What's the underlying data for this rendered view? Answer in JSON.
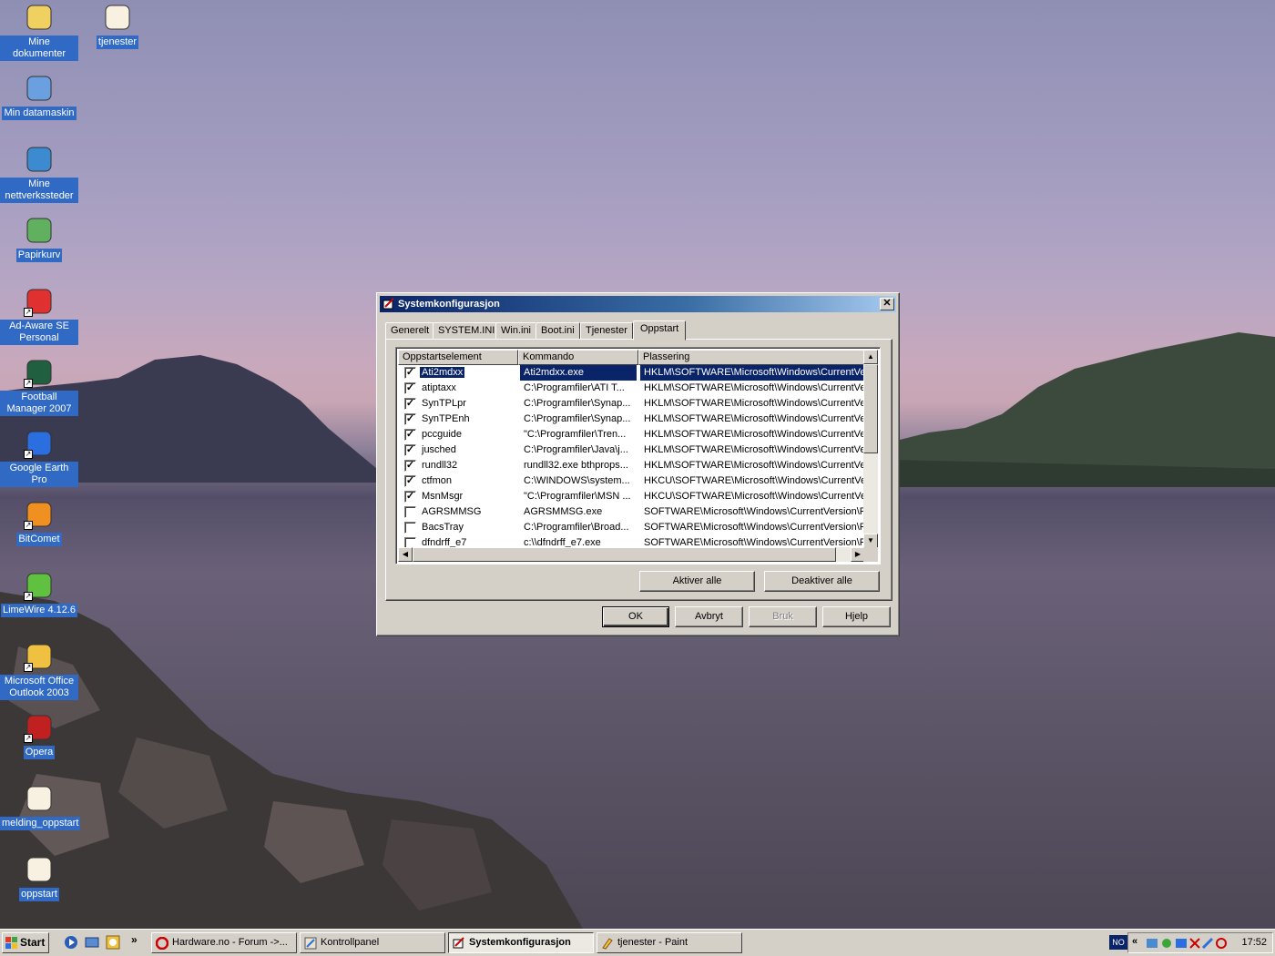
{
  "desktop": {
    "icons": [
      {
        "label": "Mine dokumenter",
        "icon": "folder-icon"
      },
      {
        "label": "tjenester",
        "icon": "paint-image-icon"
      },
      {
        "label": "Min datamaskin",
        "icon": "computer-icon"
      },
      {
        "label": "Mine nettverkssteder",
        "icon": "network-icon"
      },
      {
        "label": "Papirkurv",
        "icon": "recycle-bin-icon"
      },
      {
        "label": "Ad-Aware SE Personal",
        "icon": "adaware-icon"
      },
      {
        "label": "Football Manager 2007",
        "icon": "football-manager-icon"
      },
      {
        "label": "Google Earth Pro",
        "icon": "google-earth-icon"
      },
      {
        "label": "BitComet",
        "icon": "bitcomet-icon"
      },
      {
        "label": "LimeWire 4.12.6",
        "icon": "limewire-icon"
      },
      {
        "label": "Microsoft Office Outlook 2003",
        "icon": "outlook-icon"
      },
      {
        "label": "Opera",
        "icon": "opera-icon"
      },
      {
        "label": "melding_oppstart",
        "icon": "paint-image-icon"
      },
      {
        "label": "oppstart",
        "icon": "paint-image-icon"
      }
    ]
  },
  "dialog": {
    "title": "Systemkonfigurasjon",
    "close_glyph": "✕",
    "tabs": [
      "Generelt",
      "SYSTEM.INI",
      "Win.ini",
      "Boot.ini",
      "Tjenester",
      "Oppstart"
    ],
    "active_tab": "Oppstart",
    "columns": [
      "Oppstartselement",
      "Kommando",
      "Plassering"
    ],
    "rows": [
      {
        "checked": true,
        "item": "Ati2mdxx",
        "command": "Ati2mdxx.exe",
        "location": "HKLM\\SOFTWARE\\Microsoft\\Windows\\CurrentVer...",
        "selected": true
      },
      {
        "checked": true,
        "item": "atiptaxx",
        "command": "C:\\Programfiler\\ATI T...",
        "location": "HKLM\\SOFTWARE\\Microsoft\\Windows\\CurrentVer..."
      },
      {
        "checked": true,
        "item": "SynTPLpr",
        "command": "C:\\Programfiler\\Synap...",
        "location": "HKLM\\SOFTWARE\\Microsoft\\Windows\\CurrentVer..."
      },
      {
        "checked": true,
        "item": "SynTPEnh",
        "command": "C:\\Programfiler\\Synap...",
        "location": "HKLM\\SOFTWARE\\Microsoft\\Windows\\CurrentVer..."
      },
      {
        "checked": true,
        "item": "pccguide",
        "command": "\"C:\\Programfiler\\Tren...",
        "location": "HKLM\\SOFTWARE\\Microsoft\\Windows\\CurrentVer..."
      },
      {
        "checked": true,
        "item": "jusched",
        "command": "C:\\Programfiler\\Java\\j...",
        "location": "HKLM\\SOFTWARE\\Microsoft\\Windows\\CurrentVer..."
      },
      {
        "checked": true,
        "item": "rundll32",
        "command": "rundll32.exe bthprops...",
        "location": "HKLM\\SOFTWARE\\Microsoft\\Windows\\CurrentVer..."
      },
      {
        "checked": true,
        "item": "ctfmon",
        "command": "C:\\WINDOWS\\system...",
        "location": "HKCU\\SOFTWARE\\Microsoft\\Windows\\CurrentVer..."
      },
      {
        "checked": true,
        "item": "MsnMsgr",
        "command": "\"C:\\Programfiler\\MSN ...",
        "location": "HKCU\\SOFTWARE\\Microsoft\\Windows\\CurrentVer..."
      },
      {
        "checked": false,
        "item": "AGRSMMSG",
        "command": "AGRSMMSG.exe",
        "location": "SOFTWARE\\Microsoft\\Windows\\CurrentVersion\\Ru..."
      },
      {
        "checked": false,
        "item": "BacsTray",
        "command": "C:\\Programfiler\\Broad...",
        "location": "SOFTWARE\\Microsoft\\Windows\\CurrentVersion\\Ru..."
      },
      {
        "checked": false,
        "item": "dfndrff_e7",
        "command": "c:\\\\dfndrff_e7.exe",
        "location": "SOFTWARE\\Microsoft\\Windows\\CurrentVersion\\Ru..."
      }
    ],
    "enable_all_label": "Aktiver alle",
    "disable_all_label": "Deaktiver alle",
    "ok_label": "OK",
    "cancel_label": "Avbryt",
    "apply_label": "Bruk",
    "help_label": "Hjelp"
  },
  "taskbar": {
    "start_label": "Start",
    "overflow_glyph": "»",
    "tasks": [
      {
        "label": "Hardware.no - Forum ->...",
        "icon": "opera-icon",
        "active": false
      },
      {
        "label": "Kontrollpanel",
        "icon": "control-panel-icon",
        "active": false
      },
      {
        "label": "Systemkonfigurasjon",
        "icon": "msconfig-icon",
        "active": true
      },
      {
        "label": "tjenester - Paint",
        "icon": "paint-icon",
        "active": false
      }
    ],
    "language": "NO",
    "tray_expand": "«",
    "clock": "17:52"
  },
  "colors": {
    "selection": "#0a246a",
    "label_bg": "#316ac5",
    "face": "#d4d0c8"
  }
}
